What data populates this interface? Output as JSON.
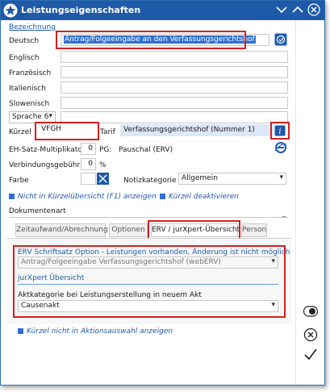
{
  "window": {
    "title": "Leistungseigenschaften"
  },
  "labels": {
    "bezeichnung": "Bezeichnung",
    "deutsch": "Deutsch",
    "englisch": "Englisch",
    "franzoesisch": "Französisch",
    "italienisch": "Italienisch",
    "slowenisch": "Slowenisch",
    "kuerzel": "Kürzel",
    "tarif": "Tarif",
    "eh_satz": "EH-Satz-Multiplikator",
    "pg": "PG:",
    "verbindungsgebuehr": "Verbindungsgebühr",
    "percent": "%",
    "farbe": "Farbe",
    "notizkategorie": "Notizkategorie",
    "dokumentenart": "Dokumentenart"
  },
  "fields": {
    "deutsch": "Antrag/Folgeeingabe an den Verfassungsgerichtshof",
    "englisch": "",
    "franzoesisch": "",
    "italienisch": "",
    "slowenisch": "",
    "language_select": "Sprache 6",
    "kuerzel": "VFGH",
    "tarif": "Verfassungsgerichtshof (Nummer 1)",
    "eh_satz": "0",
    "pauschal": "Pauschal (ERV)",
    "verbindungsgebuehr": "0",
    "notizkategorie": "Allgemein",
    "dokumentenart": ""
  },
  "checks": {
    "nicht_in_kuerzel": "Nicht in Kürzelübersicht (F1) anzeigen",
    "kuerzel_deaktiviert": "Kürzel deaktivieren",
    "nicht_in_aktion": "Kürzel nicht in Aktionsauswahl anzeigen"
  },
  "tabs": [
    {
      "label": "Zeitaufwand/Abrechnung"
    },
    {
      "label": "Optionen"
    },
    {
      "label": "ERV / jurXpert-Übersicht"
    },
    {
      "label": "Person"
    }
  ],
  "erv": {
    "option_label": "ERV Schriftsatz Option - Leistungen vorhanden, Änderung ist nicht möglich",
    "option_value": "Antrag/Folgeeingabe Verfassungsgerichtshof (webERV)",
    "section": "jurXpert Übersicht",
    "aktkategorie_label": "Aktkategorie bei Leistungserstellung in neuem Akt",
    "aktkategorie_value": "Causenakt"
  },
  "colors": {
    "title_bar": "#1e5aa8",
    "highlight": "#d61f1f",
    "accent": "#2f6fd1"
  }
}
